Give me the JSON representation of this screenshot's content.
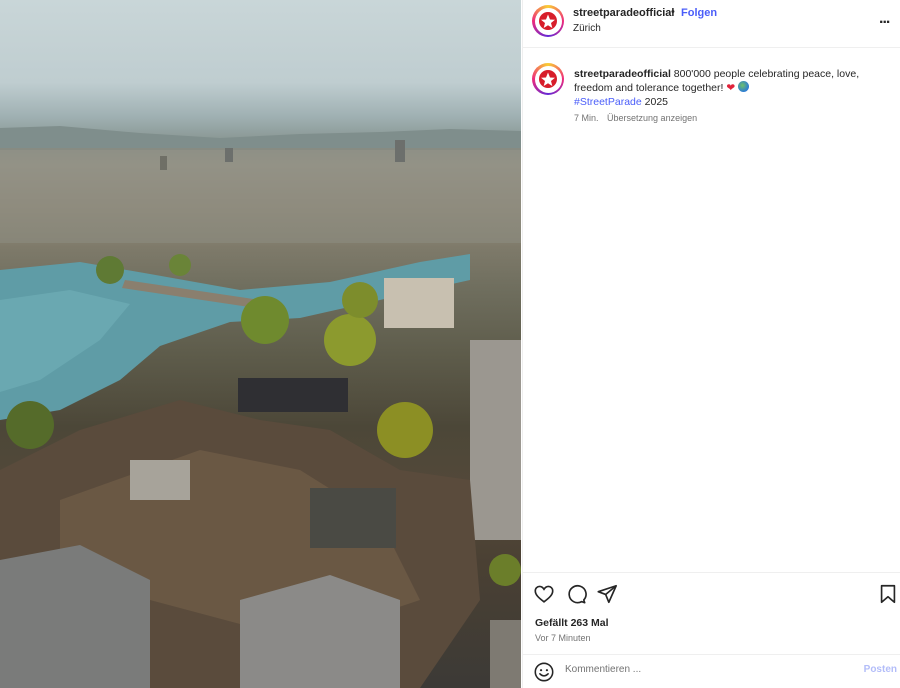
{
  "post": {
    "username": "streetparadeofficial",
    "separator": "•",
    "follow_label": "Folgen",
    "location": "Zürich",
    "more_label": "...",
    "caption_text": " 800'000 people celebrating peace, love, freedom and tolerance together! ",
    "hashtag": "#StreetParade",
    "caption_tail": " 2025",
    "heart_emoji": "❤",
    "time_short": "7 Min.",
    "translate_label": "Übersetzung anzeigen",
    "likes": "Gefällt 263 Mal",
    "time_long": "Vor 7 Minuten",
    "comment_placeholder": "Kommentieren ...",
    "post_label": "Posten"
  },
  "icons": {
    "like": "heart-outline-icon",
    "comment": "speech-bubble-icon",
    "share": "paper-plane-icon",
    "save": "bookmark-icon",
    "emoji": "smiley-icon",
    "options": "more-horizontal-icon"
  },
  "colors": {
    "link": "#4a5df9",
    "post_button_disabled": "#b3bdf9",
    "secondary_text": "#737373"
  }
}
